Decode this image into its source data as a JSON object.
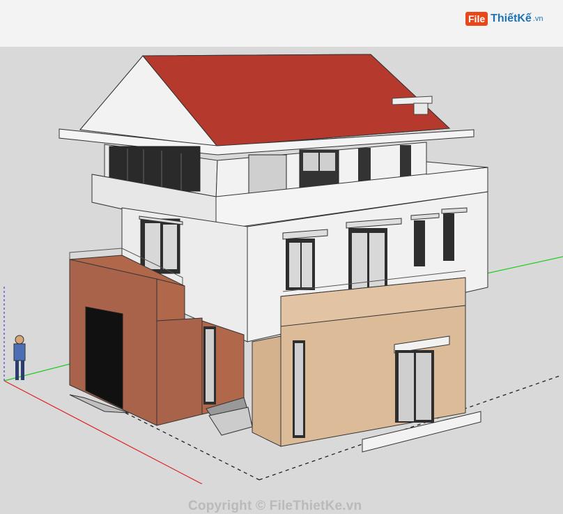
{
  "header": {
    "logo": {
      "file_label": "File",
      "brand_label": "ThiếtKế",
      "tld_label": ".vn"
    }
  },
  "viewport": {
    "watermark_text": "Copyright © FileThietKe.vn"
  },
  "colors": {
    "background": "#d9d9d9",
    "header": "#f3f3f3",
    "roof": "#b53a2d",
    "wall_white": "#eeeeee",
    "brick": "#b0674a",
    "beige": "#dcbb99",
    "axis_red": "#d22",
    "axis_green": "#2c2"
  },
  "icons": {
    "logo": "filethietke-logo",
    "person": "scale-figure-person"
  }
}
